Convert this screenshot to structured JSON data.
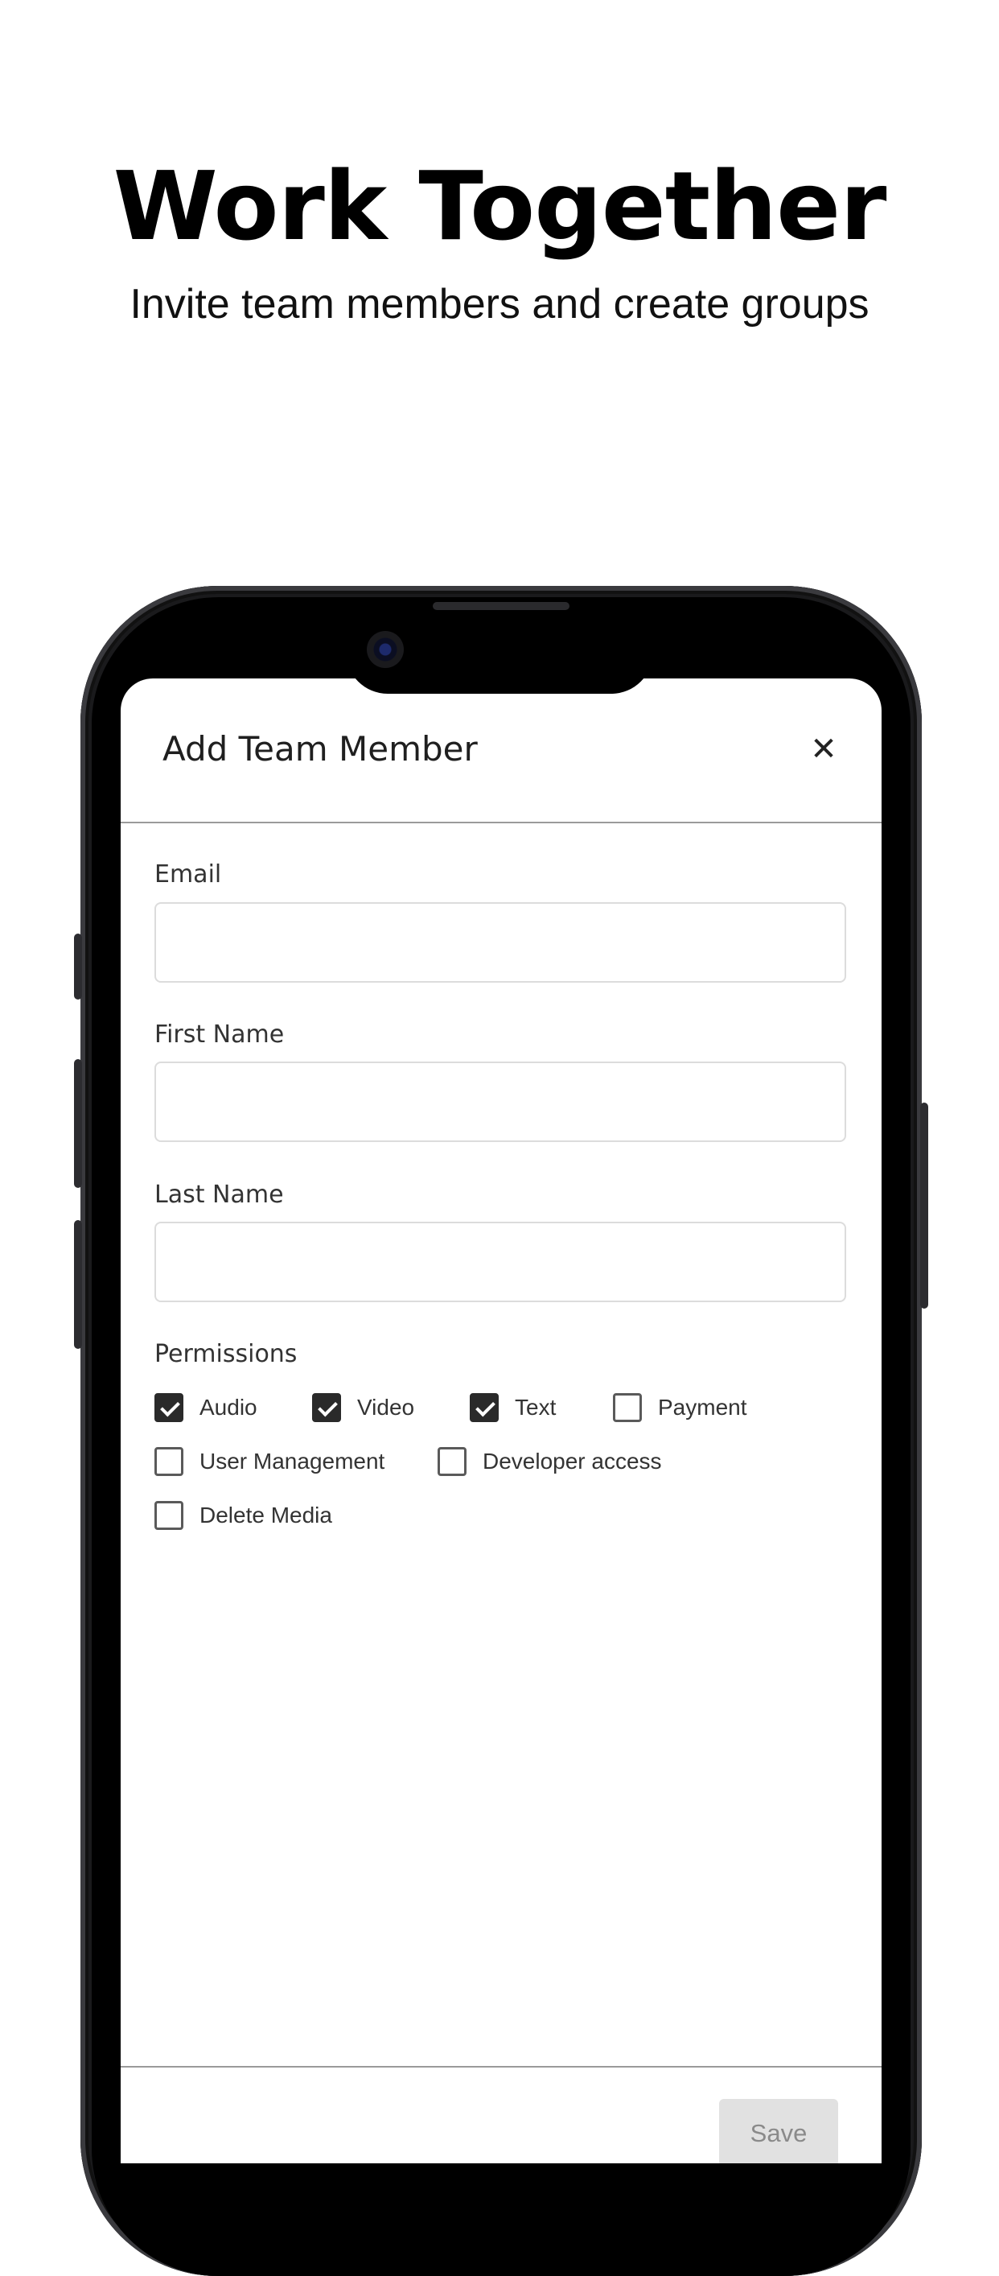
{
  "promo": {
    "headline": "Work Together",
    "subheadline": "Invite team members and create groups"
  },
  "modal": {
    "title": "Add Team Member",
    "close_icon_glyph": "✕",
    "fields": {
      "email": {
        "label": "Email",
        "value": "",
        "placeholder": ""
      },
      "first_name": {
        "label": "First Name",
        "value": "",
        "placeholder": ""
      },
      "last_name": {
        "label": "Last Name",
        "value": "",
        "placeholder": ""
      }
    },
    "permissions": {
      "label": "Permissions",
      "items": [
        {
          "label": "Audio",
          "checked": true
        },
        {
          "label": "Video",
          "checked": true
        },
        {
          "label": "Text",
          "checked": true
        },
        {
          "label": "Payment",
          "checked": false
        },
        {
          "label": "User Management",
          "checked": false
        },
        {
          "label": "Developer access",
          "checked": false
        },
        {
          "label": "Delete Media",
          "checked": false
        }
      ]
    },
    "save_label": "Save",
    "save_enabled": false
  },
  "colors": {
    "checkbox_checked": "#2a2a2a",
    "save_disabled_bg": "#e1e1e1",
    "save_disabled_text": "#8a8a8a"
  }
}
